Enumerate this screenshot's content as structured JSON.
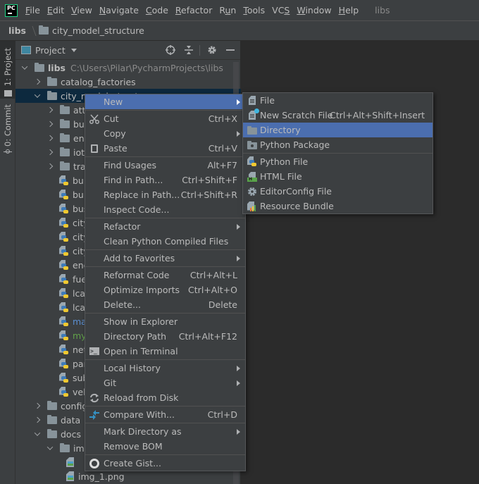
{
  "menubar": {
    "logo": "PC",
    "items": [
      {
        "label": "File",
        "mnemonic": "F"
      },
      {
        "label": "Edit",
        "mnemonic": "E"
      },
      {
        "label": "View",
        "mnemonic": "V"
      },
      {
        "label": "Navigate",
        "mnemonic": "N"
      },
      {
        "label": "Code",
        "mnemonic": "C"
      },
      {
        "label": "Refactor",
        "mnemonic": "R"
      },
      {
        "label": "Run",
        "mnemonic": "u"
      },
      {
        "label": "Tools",
        "mnemonic": "T"
      },
      {
        "label": "VCS",
        "mnemonic": "S"
      },
      {
        "label": "Window",
        "mnemonic": "W"
      },
      {
        "label": "Help",
        "mnemonic": "H"
      }
    ],
    "project_name": "libs"
  },
  "breadcrumbs": [
    "libs",
    "city_model_structure"
  ],
  "left_strip": {
    "tabs": [
      {
        "label": "1: Project",
        "active": true
      },
      {
        "label": "0: Commit",
        "active": false
      }
    ]
  },
  "project_panel": {
    "title": "Project",
    "header_buttons": [
      "locate-icon",
      "collapse-all-icon",
      "gear-icon",
      "minimize-icon"
    ],
    "tree": [
      {
        "label": "libs",
        "type": "folder",
        "level": 0,
        "expanded": true,
        "bold": true,
        "path": "C:\\Users\\Pilar\\PycharmProjects\\libs"
      },
      {
        "label": "catalog_factories",
        "type": "folder",
        "level": 1,
        "expanded": false
      },
      {
        "label": "city_model_structure",
        "type": "folder",
        "level": 1,
        "expanded": true,
        "selected": true
      },
      {
        "label": "attr",
        "type": "folder",
        "level": 2,
        "expanded": false
      },
      {
        "label": "buil",
        "type": "folder",
        "level": 2,
        "expanded": false
      },
      {
        "label": "ene",
        "type": "folder",
        "level": 2,
        "expanded": false
      },
      {
        "label": "iot",
        "type": "folder",
        "level": 2,
        "expanded": false
      },
      {
        "label": "tran",
        "type": "folder",
        "level": 2,
        "expanded": false
      },
      {
        "label": "buil",
        "type": "py",
        "level": 2
      },
      {
        "label": "buil",
        "type": "py",
        "level": 2
      },
      {
        "label": "bus",
        "type": "py",
        "level": 2
      },
      {
        "label": "city",
        "type": "py",
        "level": 2
      },
      {
        "label": "city",
        "type": "py",
        "level": 2
      },
      {
        "label": "city",
        "type": "py",
        "level": 2
      },
      {
        "label": "ene",
        "type": "py",
        "level": 2
      },
      {
        "label": "fuel",
        "type": "py",
        "level": 2
      },
      {
        "label": "lca_",
        "type": "py",
        "level": 2
      },
      {
        "label": "lca_",
        "type": "py",
        "level": 2
      },
      {
        "label": "mac",
        "type": "py",
        "level": 2,
        "color": "#5b8fd1"
      },
      {
        "label": "my_",
        "type": "py",
        "level": 2,
        "color": "#62a24a"
      },
      {
        "label": "netw",
        "type": "py",
        "level": 2
      },
      {
        "label": "part",
        "type": "py",
        "level": 2
      },
      {
        "label": "sub",
        "type": "py",
        "level": 2
      },
      {
        "label": "veh",
        "type": "py",
        "level": 2
      },
      {
        "label": "config",
        "type": "folder",
        "level": 1,
        "expanded": false
      },
      {
        "label": "data",
        "type": "folder",
        "level": 1,
        "expanded": false
      },
      {
        "label": "docs",
        "type": "folder",
        "level": 1,
        "expanded": true
      },
      {
        "label": "img",
        "type": "folder",
        "level": 2,
        "expanded": true
      },
      {
        "label": "",
        "type": "img",
        "level": 3
      },
      {
        "label": "img_1.png",
        "type": "img",
        "level": 3
      }
    ]
  },
  "context_menu": {
    "items": [
      {
        "label": "New",
        "shortcut": "",
        "submenu": true,
        "highlighted": true,
        "icon": ""
      },
      {
        "sep": true
      },
      {
        "label": "Cut",
        "shortcut": "Ctrl+X",
        "icon": "scissors-icon"
      },
      {
        "label": "Copy",
        "shortcut": "",
        "submenu": true,
        "icon": ""
      },
      {
        "label": "Paste",
        "shortcut": "Ctrl+V",
        "icon": "clipboard-icon"
      },
      {
        "sep": true
      },
      {
        "label": "Find Usages",
        "shortcut": "Alt+F7"
      },
      {
        "label": "Find in Path...",
        "shortcut": "Ctrl+Shift+F"
      },
      {
        "label": "Replace in Path...",
        "shortcut": "Ctrl+Shift+R"
      },
      {
        "label": "Inspect Code...",
        "shortcut": ""
      },
      {
        "sep": true
      },
      {
        "label": "Refactor",
        "submenu": true
      },
      {
        "label": "Clean Python Compiled Files"
      },
      {
        "sep": true
      },
      {
        "label": "Add to Favorites",
        "submenu": true
      },
      {
        "sep": true
      },
      {
        "label": "Reformat Code",
        "shortcut": "Ctrl+Alt+L"
      },
      {
        "label": "Optimize Imports",
        "shortcut": "Ctrl+Alt+O"
      },
      {
        "label": "Delete...",
        "shortcut": "Delete"
      },
      {
        "sep": true
      },
      {
        "label": "Show in Explorer"
      },
      {
        "label": "Directory Path",
        "shortcut": "Ctrl+Alt+F12"
      },
      {
        "label": "Open in Terminal",
        "icon": "terminal-icon"
      },
      {
        "sep": true
      },
      {
        "label": "Local History",
        "submenu": true
      },
      {
        "label": "Git",
        "submenu": true
      },
      {
        "label": "Reload from Disk",
        "icon": "reload-icon"
      },
      {
        "sep": true
      },
      {
        "label": "Compare With...",
        "shortcut": "Ctrl+D",
        "icon": "compare-icon"
      },
      {
        "sep": true
      },
      {
        "label": "Mark Directory as",
        "submenu": true
      },
      {
        "label": "Remove BOM"
      },
      {
        "sep": true
      },
      {
        "label": "Create Gist...",
        "icon": "github-icon"
      }
    ]
  },
  "new_submenu": {
    "items": [
      {
        "label": "File",
        "shortcut": "",
        "icon": "file-icon"
      },
      {
        "label": "New Scratch File",
        "shortcut": "Ctrl+Alt+Shift+Insert",
        "icon": "scratch-file-icon"
      },
      {
        "label": "Directory",
        "shortcut": "",
        "icon": "folder-icon",
        "highlighted": true
      },
      {
        "label": "Python Package",
        "shortcut": "",
        "icon": "package-icon"
      },
      {
        "sep": true
      },
      {
        "label": "Python File",
        "icon": "python-file-icon"
      },
      {
        "label": "HTML File",
        "icon": "html-file-icon"
      },
      {
        "label": "EditorConfig File",
        "icon": "editorconfig-icon"
      },
      {
        "label": "Resource Bundle",
        "icon": "resource-bundle-icon"
      }
    ]
  },
  "colors": {
    "highlight": "#4b6eaf",
    "selected_row": "#0d293e",
    "panel_bg": "#3c3f41",
    "editor_bg": "#2b2b2b"
  }
}
